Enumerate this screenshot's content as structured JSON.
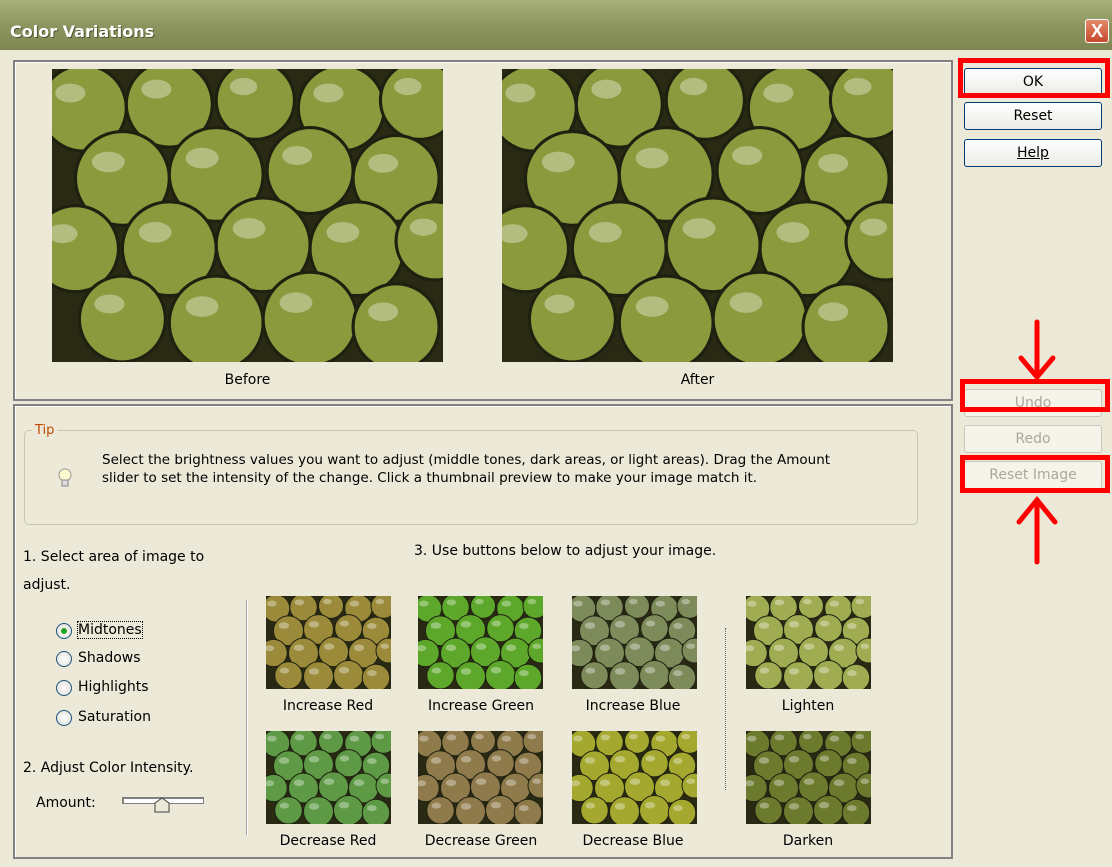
{
  "window": {
    "title": "Color Variations",
    "close_glyph": "X"
  },
  "preview": {
    "before_label": "Before",
    "after_label": "After"
  },
  "buttons": {
    "ok": "OK",
    "reset": "Reset",
    "help": "Help",
    "undo": "Undo",
    "redo": "Redo",
    "reset_image": "Reset Image"
  },
  "tip": {
    "label": "Tip",
    "text": "Select the brightness values you want to adjust (middle tones, dark areas, or light areas). Drag the Amount slider to set the intensity of the change. Click a thumbnail preview to make your image match it."
  },
  "step1": {
    "label": "1. Select area of image to adjust."
  },
  "step3": {
    "label": "3. Use buttons below to adjust your image."
  },
  "areas": {
    "midtones": "Midtones",
    "shadows": "Shadows",
    "highlights": "Highlights",
    "saturation": "Saturation",
    "selected": "Midtones"
  },
  "step2": {
    "label": "2. Adjust Color Intensity.",
    "amount_label": "Amount:",
    "amount_value": 0.5
  },
  "variations": {
    "increase_red": "Increase Red",
    "increase_green": "Increase Green",
    "increase_blue": "Increase Blue",
    "lighten": "Lighten",
    "decrease_red": "Decrease Red",
    "decrease_green": "Decrease Green",
    "decrease_blue": "Decrease Blue",
    "darken": "Darken"
  },
  "colors": {
    "highlight": "#ff0000",
    "titlebar": "#8d9560",
    "tip_label": "#c04a00"
  }
}
